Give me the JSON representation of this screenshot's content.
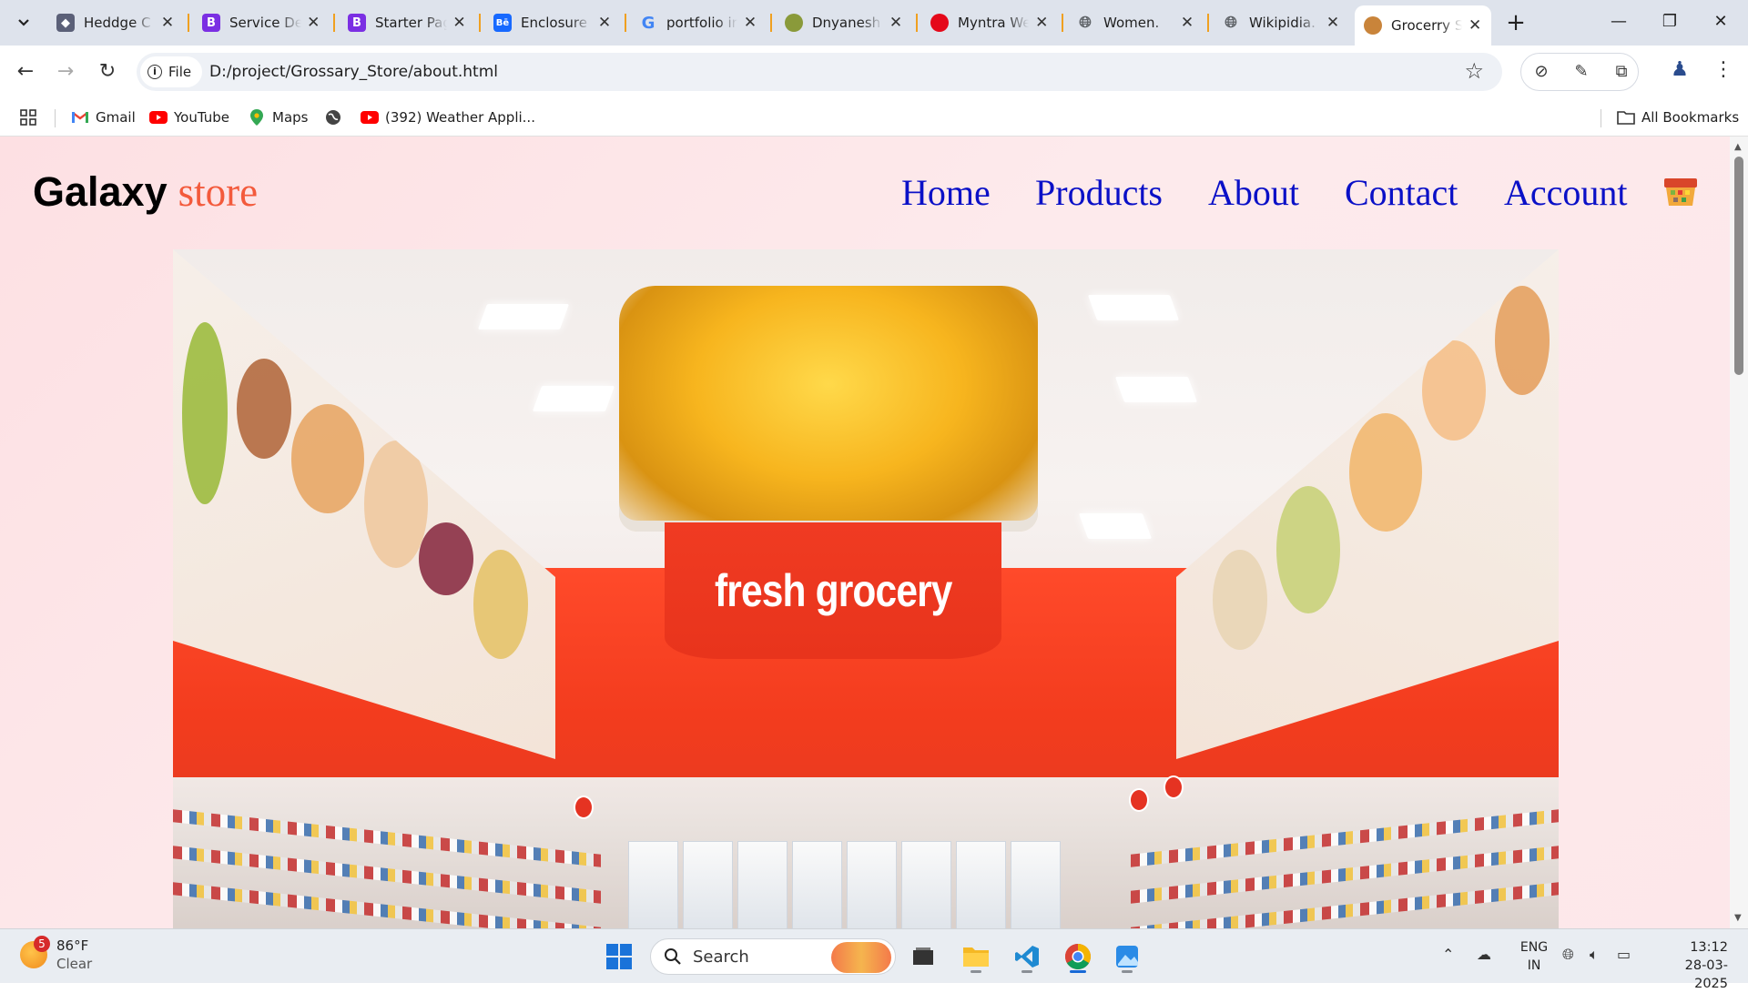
{
  "browser": {
    "tabs": [
      {
        "title": "Heddge C",
        "favicon": "heddge-favicon",
        "color": "#5b6078"
      },
      {
        "title": "Service De",
        "favicon": "bootstrap-favicon",
        "color": "#7b2fe3"
      },
      {
        "title": "Starter Pag",
        "favicon": "bootstrap-favicon",
        "color": "#7b2fe3"
      },
      {
        "title": "Enclosure",
        "favicon": "behance-favicon",
        "color": "#1769ff"
      },
      {
        "title": "portfolio ir",
        "favicon": "google-favicon",
        "color": "#ffffff"
      },
      {
        "title": "Dnyanesh",
        "favicon": "site-favicon",
        "color": "#8a9a3a"
      },
      {
        "title": "Myntra We",
        "favicon": "myntra-favicon",
        "color": "#e5091a"
      },
      {
        "title": "Women.",
        "favicon": "globe-favicon",
        "color": "#5f6368"
      },
      {
        "title": "Wikipidia.",
        "favicon": "globe-favicon",
        "color": "#5f6368"
      },
      {
        "title": "Grocerry S",
        "favicon": "grocery-favicon",
        "color": "#8a4a1a"
      }
    ],
    "active_tab_index": 9,
    "url_chip": "File",
    "url": "D:/project/Grossary_Store/about.html",
    "bookmarks": [
      "Gmail",
      "YouTube",
      "Maps",
      "",
      "(392) Weather Appli..."
    ],
    "all_bookmarks": "All Bookmarks"
  },
  "site": {
    "logo_part1": "Galaxy",
    "logo_part2": "store",
    "logo_accent": "#f35a3c",
    "nav": [
      "Home",
      "Products",
      "About",
      "Contact",
      "Account"
    ],
    "nav_color": "#0a10c7",
    "hero_sign_text": "fresh grocery",
    "cart_icon": "shopping-cart-icon"
  },
  "taskbar": {
    "weather_temp": "86°F",
    "weather_desc": "Clear",
    "weather_badge": "5",
    "search_label": "Search",
    "lang_line1": "ENG",
    "lang_line2": "IN",
    "time": "13:12",
    "date": "28-03-2025"
  }
}
